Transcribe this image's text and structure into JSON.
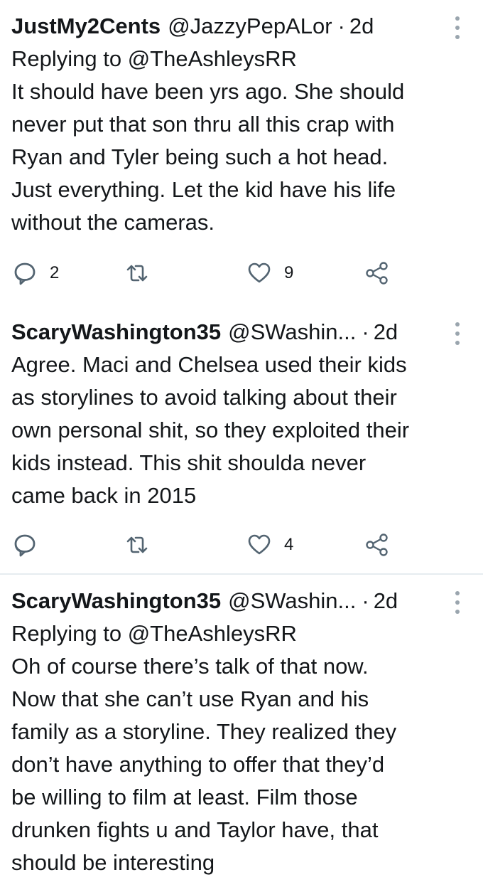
{
  "tweets": [
    {
      "name": "JustMy2Cents",
      "handle": "@JazzyPepALor",
      "separator": "·",
      "time": "2d",
      "reply_to": "Replying to @TheAshleysRR",
      "text": "It should have been yrs ago. She should\nnever put that son thru all this crap with\nRyan and Tyler being such a hot head.\nJust everything. Let the kid have his life\nwithout the cameras.",
      "reply_count": "2",
      "retweet_count": "",
      "like_count": "9"
    },
    {
      "name": "ScaryWashington35",
      "handle": "@SWashin...",
      "separator": "·",
      "time": "2d",
      "reply_to": "",
      "text": "Agree. Maci and Chelsea used their kids\nas storylines to avoid talking about their\nown personal shit, so they exploited their\nkids instead. This shit shoulda never\ncame back in 2015",
      "reply_count": "",
      "retweet_count": "",
      "like_count": "4"
    },
    {
      "name": "ScaryWashington35",
      "handle": "@SWashin...",
      "separator": "·",
      "time": "2d",
      "reply_to": "Replying to @TheAshleysRR",
      "text": "Oh of course there’s talk of that now.\nNow that she can’t use Ryan and his\nfamily as a storyline. They realized they\ndon’t have anything to offer that they’d\nbe willing to film at least. Film those\ndrunken fights u and Taylor have, that\nshould be interesting"
    }
  ],
  "colors": {
    "text": "#14171a",
    "icon": "#536471",
    "divider": "#e6ecf0",
    "more": "#9aa5ae"
  },
  "icons": [
    "reply-icon",
    "retweet-icon",
    "like-icon",
    "share-icon",
    "more-options-icon"
  ]
}
